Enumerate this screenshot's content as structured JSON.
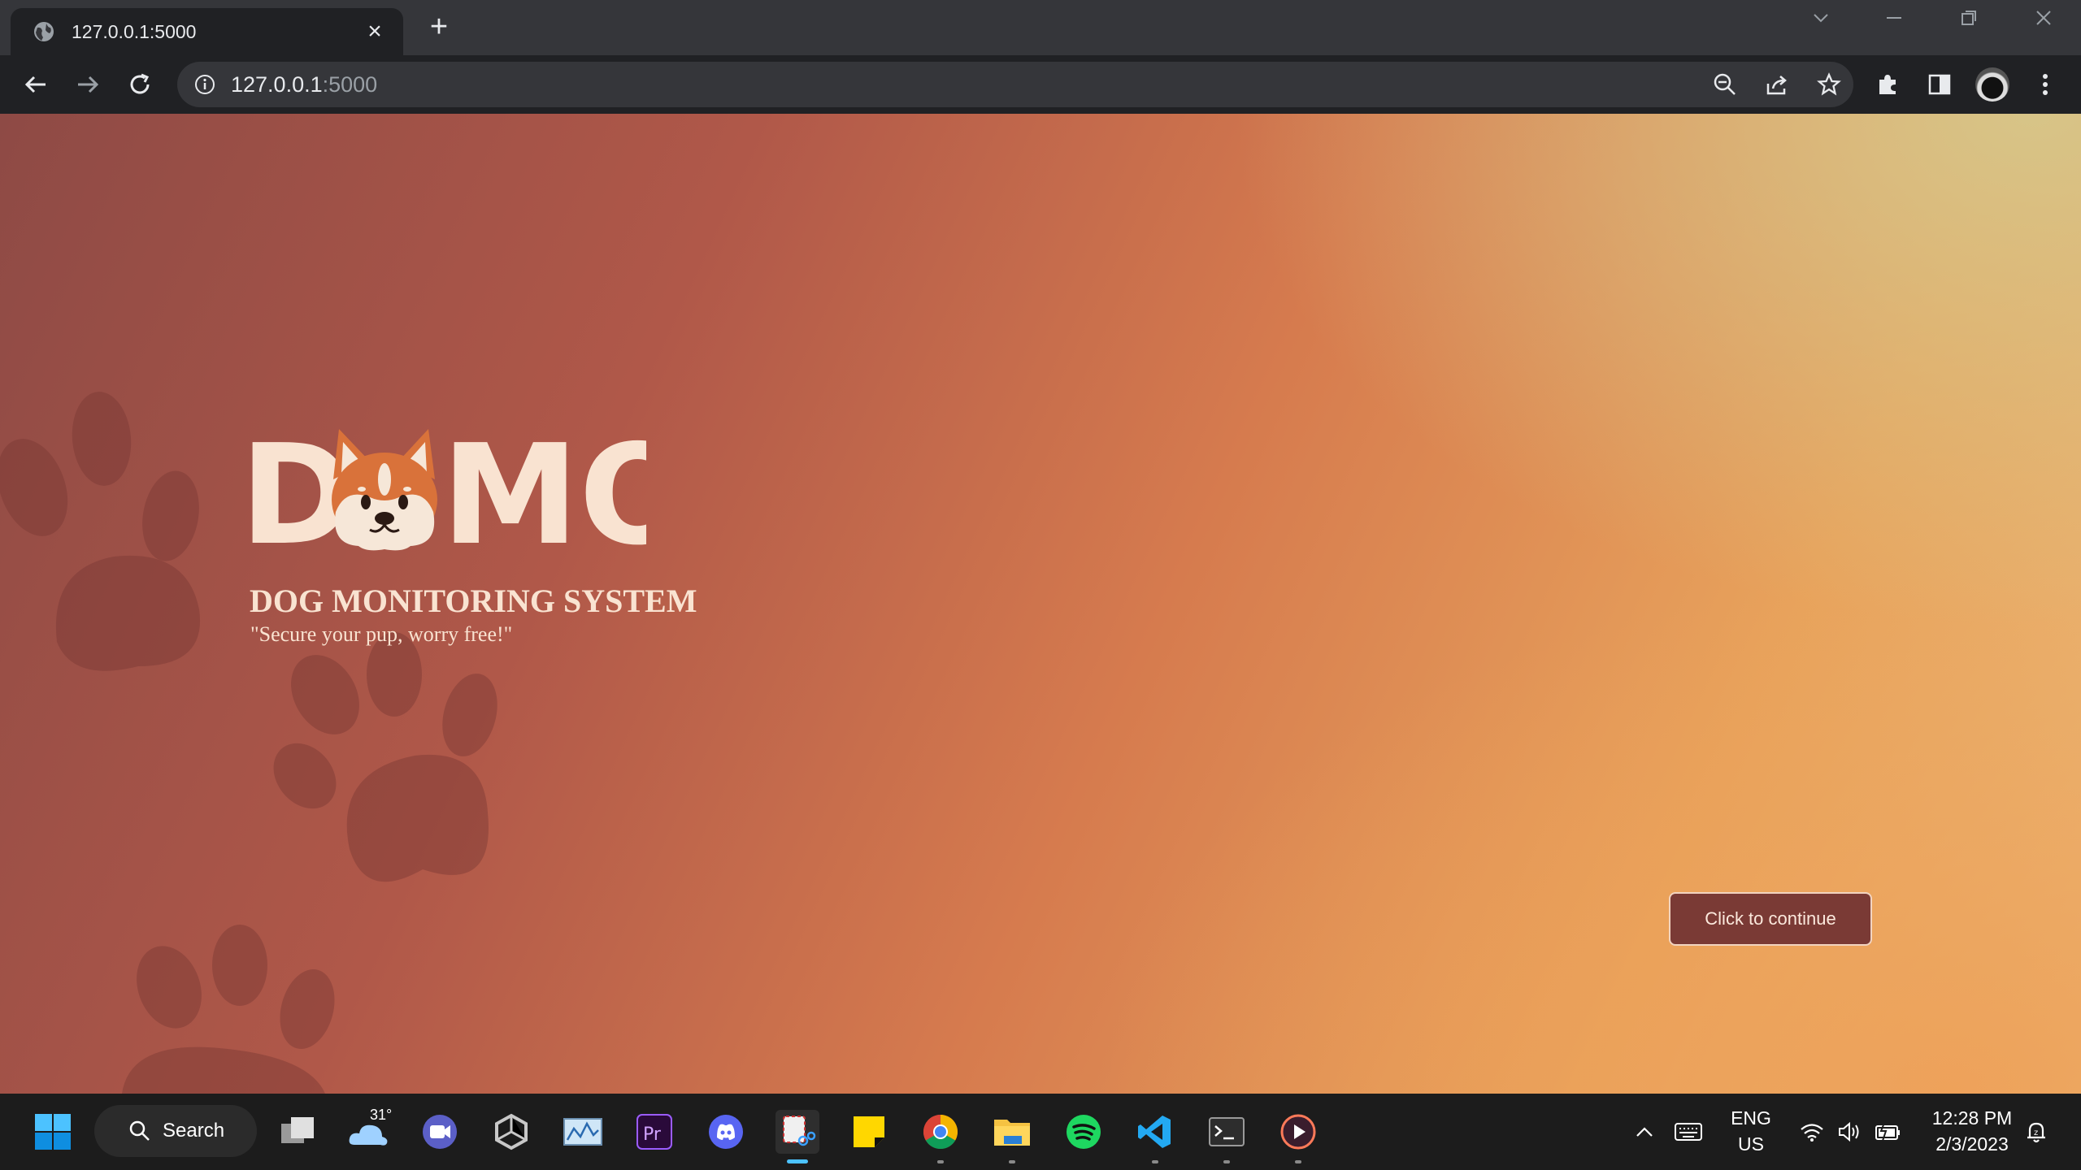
{
  "browser": {
    "tab_title": "127.0.0.1:5000",
    "url_host": "127.0.0.1",
    "url_port": ":5000"
  },
  "page": {
    "logo_letters_left": "D",
    "logo_letters_right": "MO",
    "subtitle": "DOG MONITORING SYSTEM",
    "tagline": "\"Secure your pup, worry free!\"",
    "continue_label": "Click to continue",
    "colors": {
      "button_bg": "#7a3a35",
      "text": "#f9e3d1"
    }
  },
  "taskbar": {
    "search_label": "Search",
    "weather_temp": "31°",
    "language_line1": "ENG",
    "language_line2": "US",
    "time": "12:28 PM",
    "date": "2/3/2023"
  }
}
